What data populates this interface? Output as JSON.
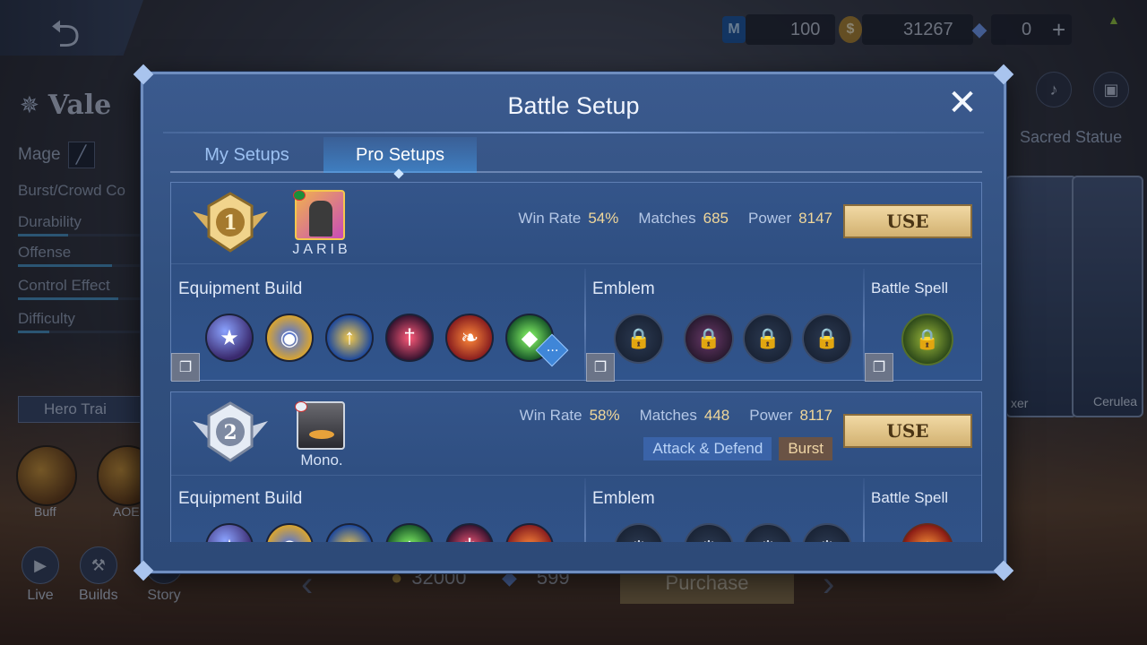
{
  "background": {
    "hero_name": "Vale",
    "role": "Mage",
    "specialty": "Burst/Crowd Co",
    "stats": [
      {
        "label": "Durability",
        "level": 0.4
      },
      {
        "label": "Offense",
        "level": 0.75
      },
      {
        "label": "Control Effect",
        "level": 0.8
      },
      {
        "label": "Difficulty",
        "level": 0.25
      }
    ],
    "hero_train_label": "Hero Trai",
    "skills": [
      {
        "label": "Buff"
      },
      {
        "label": "AOE"
      }
    ],
    "bottom_nav": [
      {
        "label": "Live",
        "icon": "video-icon"
      },
      {
        "label": "Builds",
        "icon": "builds-icon"
      },
      {
        "label": "Story",
        "icon": "book-icon"
      }
    ],
    "currency": {
      "tickets": "100",
      "battle_points": "31267",
      "diamonds": "0"
    },
    "sacred_statue_label": "Sacred Statue",
    "skin_cards": [
      "xer",
      "Cerulea"
    ],
    "price_bp": "32000",
    "price_diamonds": "599",
    "purchase_label": "Purchase"
  },
  "modal": {
    "title": "Battle Setup",
    "tabs": [
      {
        "label": "My Setups",
        "active": false
      },
      {
        "label": "Pro Setups",
        "active": true
      }
    ],
    "setups": [
      {
        "rank": "1",
        "player_name": "JARIB",
        "win_rate_label": "Win Rate",
        "win_rate": "54%",
        "matches_label": "Matches",
        "matches": "685",
        "power_label": "Power",
        "power": "8147",
        "use_label": "USE",
        "tags": [],
        "equipment_title": "Equipment Build",
        "emblem_title": "Emblem",
        "spell_title": "Battle Spell",
        "items": [
          "boots-icon",
          "orb-icon",
          "trident-icon",
          "dagger-icon",
          "fire-feather-icon",
          "crystal-icon"
        ],
        "spell_icon": "spell-lock-icon"
      },
      {
        "rank": "2",
        "player_name": "Mono.",
        "win_rate_label": "Win Rate",
        "win_rate": "58%",
        "matches_label": "Matches",
        "matches": "448",
        "power_label": "Power",
        "power": "8117",
        "use_label": "USE",
        "tags": [
          "Attack & Defend",
          "Burst"
        ],
        "equipment_title": "Equipment Build",
        "emblem_title": "Emblem",
        "spell_title": "Battle Spell",
        "items": [
          "boots-icon",
          "orb-icon",
          "trident-icon",
          "crystal-icon",
          "dagger-icon",
          "fire-feather-icon"
        ],
        "spell_icon": "fire-spell-icon"
      }
    ]
  }
}
